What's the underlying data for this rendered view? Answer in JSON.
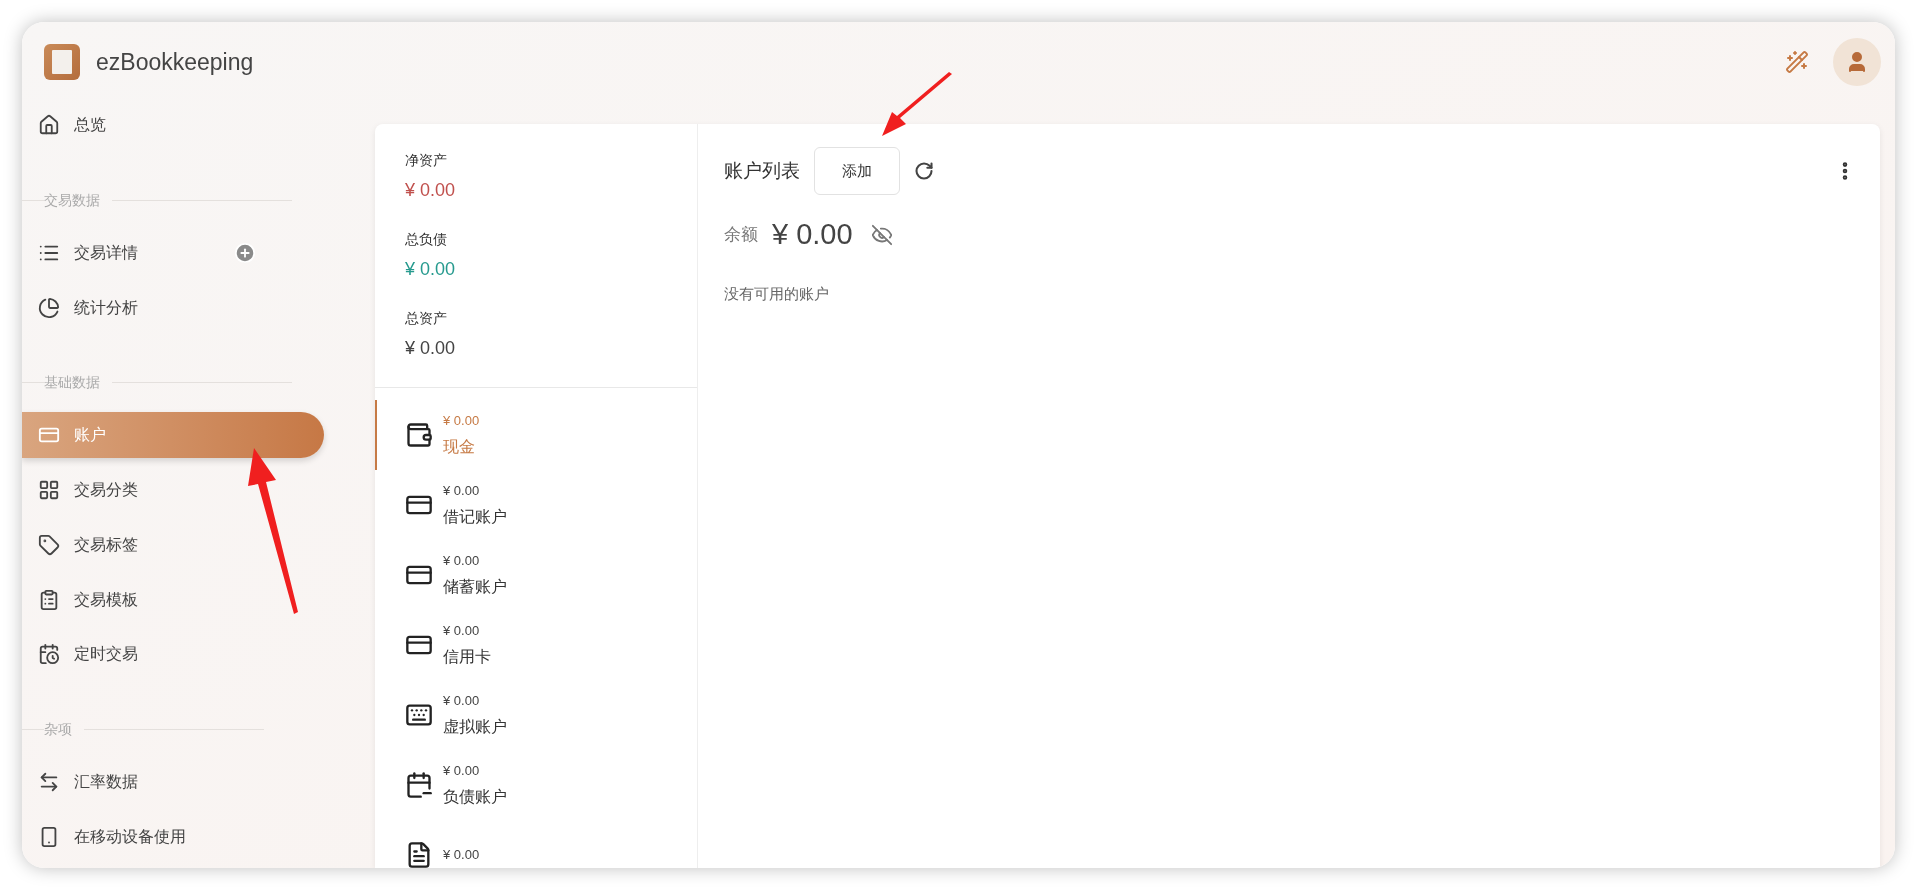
{
  "app": {
    "title": "ezBookkeeping"
  },
  "sidebar": {
    "items": [
      {
        "kind": "item",
        "label": "总览",
        "selected": false
      },
      {
        "kind": "section",
        "label": "交易数据"
      },
      {
        "kind": "item",
        "label": "交易详情",
        "selected": false,
        "has_add": true
      },
      {
        "kind": "item",
        "label": "统计分析",
        "selected": false
      },
      {
        "kind": "section",
        "label": "基础数据"
      },
      {
        "kind": "item",
        "label": "账户",
        "selected": true
      },
      {
        "kind": "item",
        "label": "交易分类",
        "selected": false
      },
      {
        "kind": "item",
        "label": "交易标签",
        "selected": false
      },
      {
        "kind": "item",
        "label": "交易模板",
        "selected": false
      },
      {
        "kind": "item",
        "label": "定时交易",
        "selected": false
      },
      {
        "kind": "section",
        "label": "杂项"
      },
      {
        "kind": "item",
        "label": "汇率数据",
        "selected": false
      },
      {
        "kind": "item",
        "label": "在移动设备使用",
        "selected": false
      }
    ]
  },
  "summary": [
    {
      "label": "净资产",
      "value": "¥ 0.00",
      "color": "#c0504d"
    },
    {
      "label": "总负债",
      "value": "¥ 0.00",
      "color": "#269a8e"
    },
    {
      "label": "总资产",
      "value": "¥ 0.00",
      "color": "#444444"
    }
  ],
  "account_types": [
    {
      "amount": "¥ 0.00",
      "name": "现金",
      "selected": true
    },
    {
      "amount": "¥ 0.00",
      "name": "借记账户",
      "selected": false
    },
    {
      "amount": "¥ 0.00",
      "name": "储蓄账户",
      "selected": false
    },
    {
      "amount": "¥ 0.00",
      "name": "信用卡",
      "selected": false
    },
    {
      "amount": "¥ 0.00",
      "name": "虚拟账户",
      "selected": false
    },
    {
      "amount": "¥ 0.00",
      "name": "负债账户",
      "selected": false
    },
    {
      "amount": "¥ 0.00"
    }
  ],
  "account_list": {
    "title": "账户列表",
    "add_button": "添加",
    "balance_label": "余额",
    "balance": "¥ 0.00",
    "empty_message": "没有可用的账户"
  }
}
